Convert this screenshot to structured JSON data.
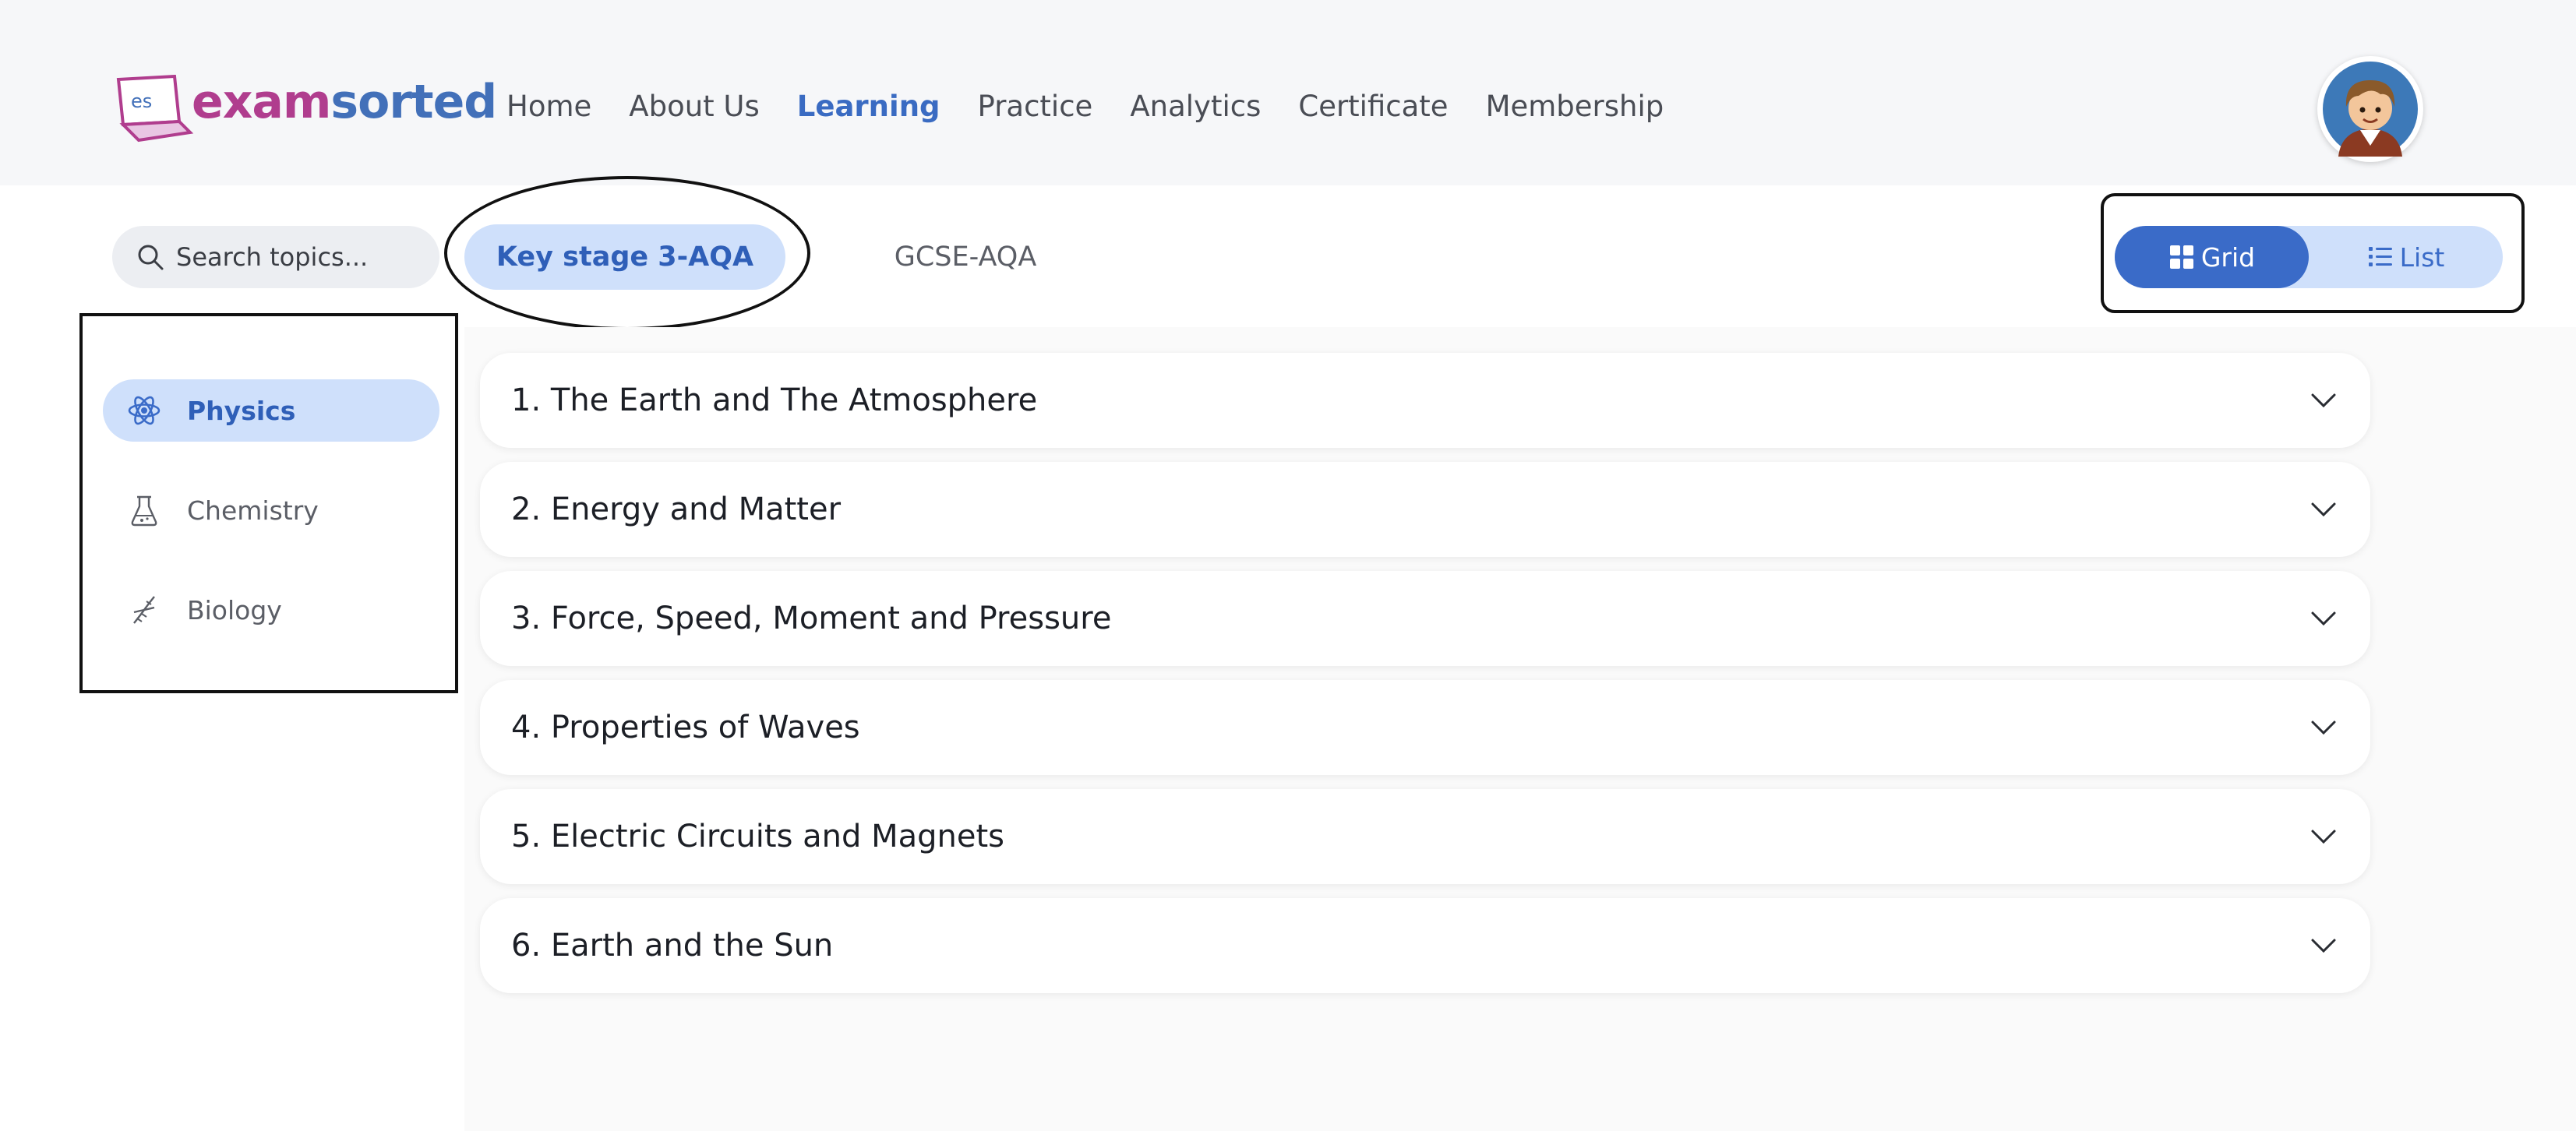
{
  "logo": {
    "mark_text": "es",
    "exam": "exam",
    "sorted": "sorted"
  },
  "nav": {
    "items": [
      {
        "label": "Home",
        "active": false
      },
      {
        "label": "About Us",
        "active": false
      },
      {
        "label": "Learning",
        "active": true
      },
      {
        "label": "Practice",
        "active": false
      },
      {
        "label": "Analytics",
        "active": false
      },
      {
        "label": "Certificate",
        "active": false
      },
      {
        "label": "Membership",
        "active": false
      }
    ]
  },
  "search": {
    "placeholder": "Search topics...",
    "value": ""
  },
  "stages": [
    {
      "label": "Key stage 3-AQA",
      "active": true
    },
    {
      "label": "GCSE-AQA",
      "active": false
    }
  ],
  "view_toggle": {
    "grid_label": "Grid",
    "list_label": "List",
    "selected": "Grid"
  },
  "subjects": [
    {
      "label": "Physics",
      "icon": "atom-icon",
      "active": true
    },
    {
      "label": "Chemistry",
      "icon": "flask-icon",
      "active": false
    },
    {
      "label": "Biology",
      "icon": "dna-icon",
      "active": false
    }
  ],
  "topics": [
    {
      "title": "1. The Earth and The Atmosphere"
    },
    {
      "title": "2. Energy and Matter"
    },
    {
      "title": "3. Force, Speed, Moment and Pressure"
    },
    {
      "title": "4. Properties of Waves"
    },
    {
      "title": "5. Electric Circuits and Magnets"
    },
    {
      "title": "6. Earth and the Sun"
    }
  ],
  "colors": {
    "accent": "#3a6bc8",
    "accent_light": "#cfe0fb",
    "logo_pink": "#b03d8e",
    "logo_blue": "#4270b9"
  }
}
